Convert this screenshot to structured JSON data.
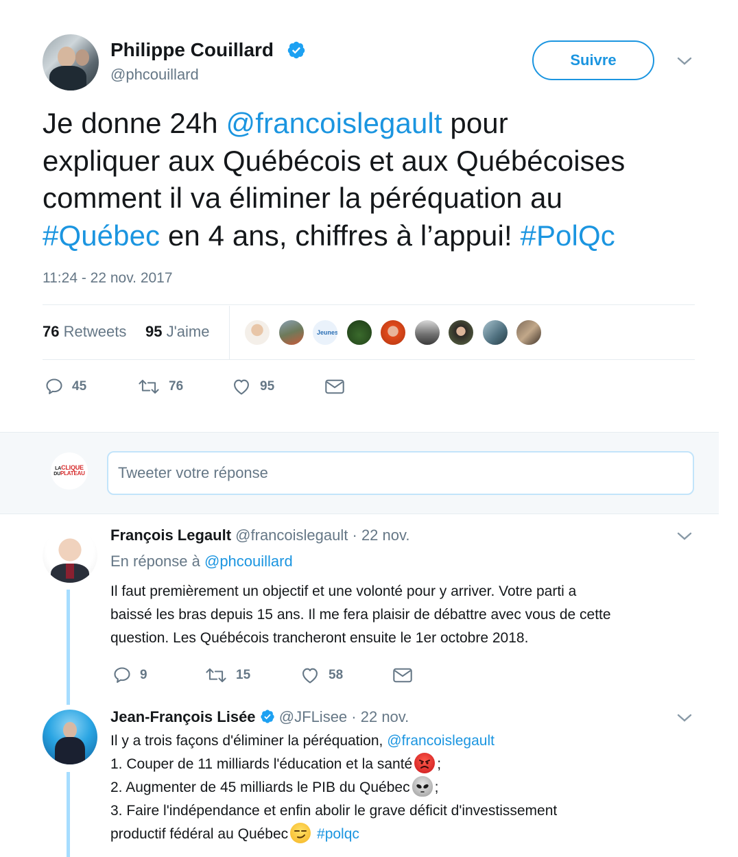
{
  "main_tweet": {
    "author_name": "Philippe Couillard",
    "author_handle": "@phcouillard",
    "follow_label": "Suivre",
    "text_line1_a": "Je donne 24h ",
    "text_line1_mention": "@francoislegault",
    "text_line1_b": " pour",
    "text_line2": "expliquer aux Québécois et aux Québécoises",
    "text_line3": "comment il va éliminer la péréquation au",
    "text_line4_hashtag1": "#Québec",
    "text_line4_b": " en 4 ans, chiffres à l’appui! ",
    "text_line4_hashtag2": "#PolQc",
    "timestamp": "11:24 - 22 nov. 2017",
    "retweets_count": "76",
    "retweets_label": "Retweets",
    "likes_count": "95",
    "likes_label": "J'aime",
    "reply_count": "45",
    "retweet_count": "76",
    "like_count": "95"
  },
  "reply_box": {
    "placeholder": "Tweeter votre réponse",
    "avatar_text_1": "LA",
    "avatar_text_2": "CLIQUE",
    "avatar_text_3": "DU",
    "avatar_text_4": "PLATEAU"
  },
  "replies": [
    {
      "author_name": "François Legault",
      "author_handle": "@francoislegault",
      "date": "· 22 nov.",
      "in_reply_prefix": "En réponse à ",
      "in_reply_handle": "@phcouillard",
      "line1": "Il faut premièrement un objectif et une volonté pour y arriver. Votre parti a",
      "line2": "baissé les bras depuis 15 ans. Il me fera plaisir de débattre avec vous de cette",
      "line3": "question. Les Québécois trancheront ensuite le 1er octobre 2018.",
      "reply_count": "9",
      "retweet_count": "15",
      "like_count": "58"
    },
    {
      "author_name": "Jean-François Lisée",
      "author_handle": "@JFLisee",
      "date": "· 22 nov.",
      "line1": "Il y a trois façons d'éliminer la péréquation, ",
      "line1_mention": "@francoislegault",
      "line2": "1. Couper de 11 milliards l'éducation et la santé",
      "line2_end": ";",
      "line3": "2. Augmenter de 45 milliards le PIB du Québec",
      "line3_end": ";",
      "line4": "3. Faire l'indépendance et enfin abolir le grave déficit d'investissement",
      "line5": "productif fédéral au Québec",
      "line5_hashtag": "#polqc"
    }
  ],
  "colors": {
    "link": "#1b95e0",
    "muted": "#657786",
    "thread_line": "#a6ddff",
    "verified": "#1da1f2"
  },
  "icons": [
    "verified-badge-icon",
    "chevron-down-icon",
    "reply-icon",
    "retweet-icon",
    "heart-icon",
    "envelope-icon",
    "angry-face-emoji",
    "alien-emoji",
    "smirk-emoji"
  ]
}
